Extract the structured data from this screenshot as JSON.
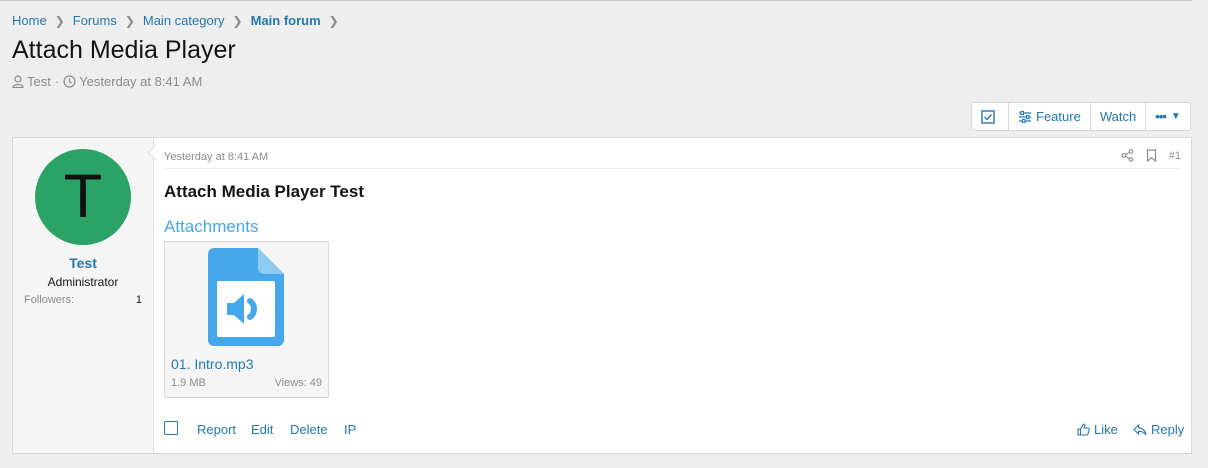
{
  "breadcrumb": {
    "home": "Home",
    "forums": "Forums",
    "category": "Main category",
    "forum": "Main forum"
  },
  "thread": {
    "title": "Attach Media Player",
    "author": "Test",
    "separator": "·",
    "date": "Yesterday at 8:41 AM"
  },
  "toolbar": {
    "feature_label": "Feature",
    "watch_label": "Watch",
    "more_label": "•••"
  },
  "user": {
    "avatar_letter": "T",
    "avatar_color": "#2ba366",
    "name": "Test",
    "role": "Administrator",
    "followers_label": "Followers:",
    "followers_value": "1"
  },
  "post": {
    "time": "Yesterday at 8:41 AM",
    "number": "#1",
    "title": "Attach Media Player Test",
    "attachments_heading": "Attachments",
    "attachment": {
      "name": "01. Intro.mp3",
      "size": "1.9 MB",
      "views": "Views: 49",
      "icon_color": "#47a7eb"
    }
  },
  "actions": {
    "report": "Report",
    "edit": "Edit",
    "delete": "Delete",
    "ip": "IP",
    "like": "Like",
    "reply": "Reply"
  },
  "colors": {
    "link": "#2577b1",
    "accent": "#47a7eb"
  }
}
